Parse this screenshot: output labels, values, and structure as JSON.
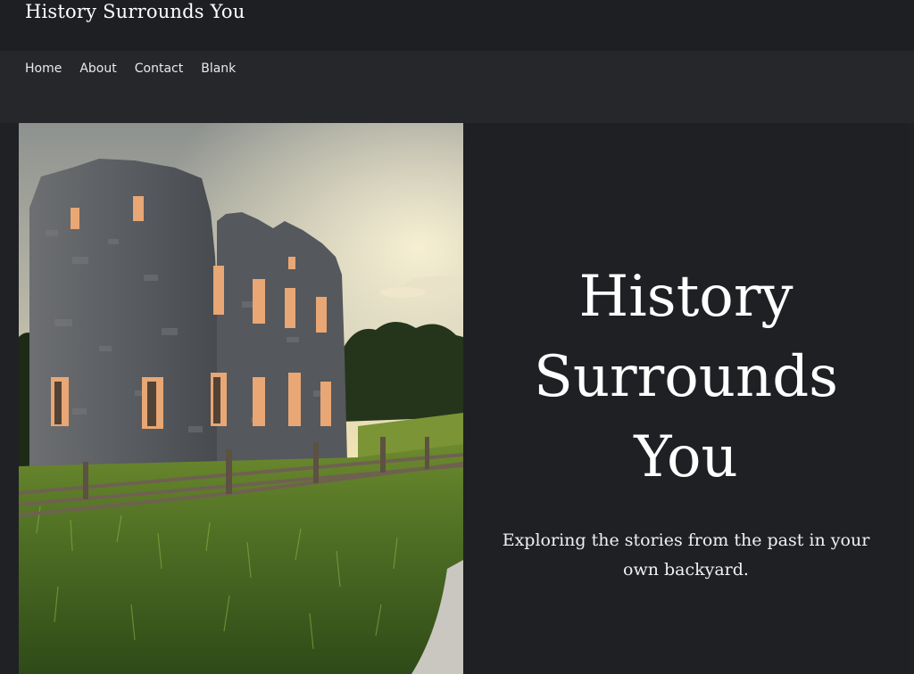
{
  "site": {
    "title": "History Surrounds You"
  },
  "nav": {
    "items": [
      {
        "label": "Home"
      },
      {
        "label": "About"
      },
      {
        "label": "Contact"
      },
      {
        "label": "Blank"
      }
    ]
  },
  "hero": {
    "heading": "History Surrounds You",
    "subheading": "Exploring the stories from the past in your own backyard.",
    "image_subject": "stone-mill-ruin-at-sunset"
  },
  "colors": {
    "header_bg": "#1e1f23",
    "nav_bg": "#26272b",
    "hero_bg": "#1f2024",
    "text": "#ffffff"
  }
}
